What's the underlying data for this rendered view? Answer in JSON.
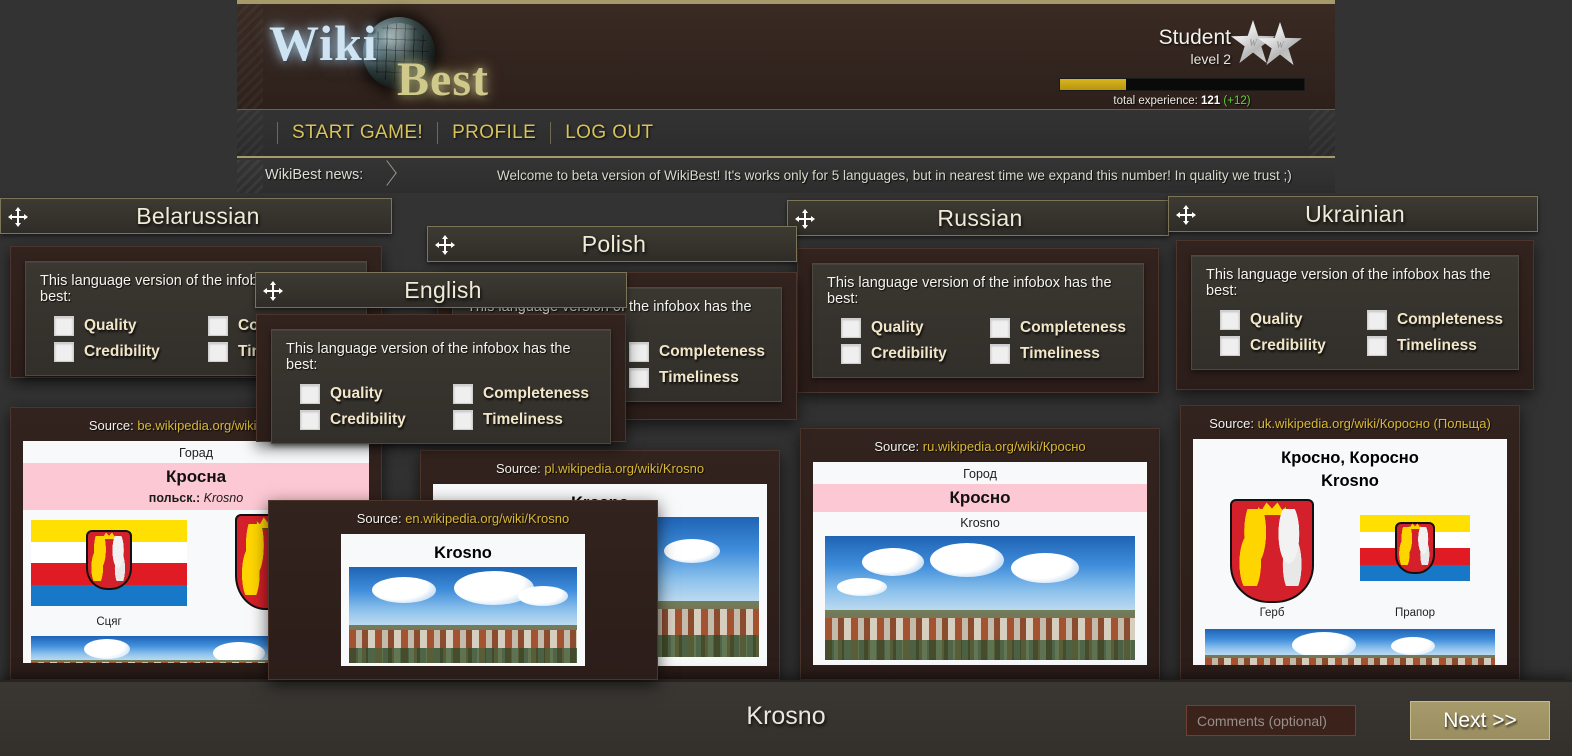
{
  "app": {
    "logo_wiki": "Wiki",
    "logo_best": "Best",
    "brand_gold": "#a79a6a",
    "accent_yellow": "#d8c25a",
    "xp_green": "#5fd13d"
  },
  "user": {
    "rank": "Student",
    "level": "level 2",
    "stars": 2,
    "xp_percent": 27,
    "xp_label": "total experience:",
    "xp_value": "121",
    "xp_gain": "(+12)"
  },
  "nav": {
    "items": [
      {
        "label": "START GAME!",
        "name": "nav-start-game"
      },
      {
        "label": "PROFILE",
        "name": "nav-profile"
      },
      {
        "label": "LOG OUT",
        "name": "nav-log-out"
      }
    ]
  },
  "news": {
    "label": "WikiBest news:",
    "text": "Welcome to beta version of WikiBest! It's works only for 5 languages, but in nearest time we expand this number! In quality we trust ;)"
  },
  "vote": {
    "prompt": "This language version of the infobox has the best:",
    "options": [
      "Quality",
      "Completeness",
      "Credibility",
      "Timeliness"
    ]
  },
  "panels": [
    {
      "title": "Belarussian"
    },
    {
      "title": "Polish"
    },
    {
      "title": "Russian"
    },
    {
      "title": "Ukrainian"
    },
    {
      "title": "English"
    }
  ],
  "cards": {
    "belarussian": {
      "source_prefix": "Source:",
      "source_url": "be.wikipedia.org/wiki/Кросна",
      "ib_sub": "Горад",
      "ib_title": "Кросна",
      "ib_alt_prefix": "польск.:",
      "ib_alt": "Krosno",
      "ib_caption": "Сцяг"
    },
    "english": {
      "source_prefix": "Source:",
      "source_url": "en.wikipedia.org/wiki/Krosno",
      "ib_title": "Krosno"
    },
    "polish": {
      "source_prefix": "Source:",
      "source_url": "pl.wikipedia.org/wiki/Krosno",
      "ib_title": "Krosno"
    },
    "russian": {
      "source_prefix": "Source:",
      "source_url": "ru.wikipedia.org/wiki/Кросно",
      "ib_sub": "Город",
      "ib_title": "Кросно",
      "ib_latin": "Krosno"
    },
    "ukrainian": {
      "source_prefix": "Source:",
      "source_url": "uk.wikipedia.org/wiki/Коросно (Польща)",
      "ib_title": "Кросно, Коросно",
      "ib_title2": "Krosno",
      "coa_caption": "Герб",
      "flag_caption": "Прапор"
    }
  },
  "footer": {
    "article_title": "Krosno",
    "comments_placeholder": "Comments (optional)",
    "next_label": "Next >>"
  }
}
